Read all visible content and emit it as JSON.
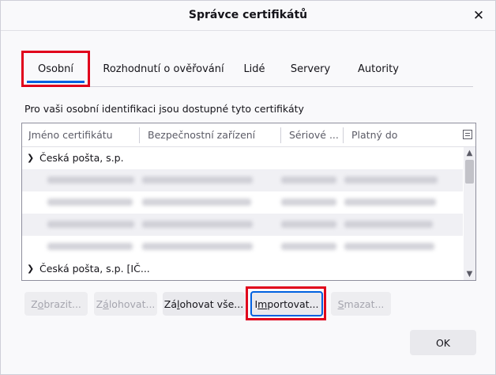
{
  "dialog": {
    "title": "Správce certifikátů",
    "close_icon": "close-icon"
  },
  "tabs": [
    {
      "label": "Osobní",
      "selected": true
    },
    {
      "label": "Rozhodnutí o ověřování"
    },
    {
      "label": "Lidé"
    },
    {
      "label": "Servery"
    },
    {
      "label": "Autority"
    }
  ],
  "description": "Pro vaši osobní identifikaci jsou dostupné tyto certifikáty",
  "tree": {
    "columns": [
      "Jméno certifikátu",
      "Bezpečnostní zařízení",
      "Sériové ...",
      "Platný do"
    ],
    "groups": [
      {
        "label": "Česká pošta, s.p.",
        "expanded": true
      },
      {
        "label": "Česká pošta, s.p. [IČ...",
        "expanded": true
      }
    ],
    "blurred_rows": 4
  },
  "buttons": {
    "view": {
      "label_pre": "Z",
      "label_u": "o",
      "label_post": "brazit..."
    },
    "backup": {
      "label_pre": "Z",
      "label_u": "á",
      "label_post": "lohovat..."
    },
    "backup_all": {
      "label_pre": "Zá",
      "label_u": "l",
      "label_post": "ohovat vše..."
    },
    "import": {
      "label_pre": "I",
      "label_u": "m",
      "label_post": "portovat..."
    },
    "delete": {
      "label_pre": "",
      "label_u": "S",
      "label_post": "mazat..."
    },
    "ok": {
      "label": "OK"
    }
  },
  "colors": {
    "highlight": "#e0001b",
    "accent": "#0061e0"
  }
}
